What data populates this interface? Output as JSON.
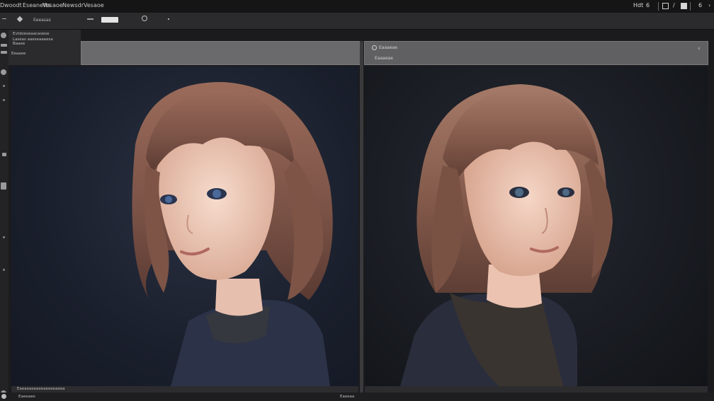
{
  "menu": {
    "items": [
      "Dwoodt",
      "Eseanetts",
      "Vesaoe",
      "Newsdr",
      "Vesaoe"
    ]
  },
  "title_right": {
    "label": "Hdt",
    "glyph": "6",
    "glyph2": "6",
    "pen": "/"
  },
  "toolbar": {
    "left_label": "Eeeasas"
  },
  "info_panel": {
    "line1": "Evtdoeseaacaoese",
    "line2": "Laseas aaeseaaeesa",
    "line3": "Baaee",
    "line4": "Eeaaee"
  },
  "right_panel": {
    "title": "Eaaaeae",
    "subtitle": "Eaaaeae",
    "chevron": "‹"
  },
  "status": {
    "left": "Eaeaeaeeaeeaeeeeaeea",
    "bottom_left": "Eaeeaee",
    "bottom_mid": "Eaeeaa"
  },
  "colors": {
    "bg": "#1b1b1d",
    "panel": "#2b2b2d",
    "header_left": "#6a6a6c",
    "header_right": "#606062",
    "hair": "#8a5e4f",
    "skin": "#f0cdbc",
    "sweater": "#2c3247"
  },
  "icons": {
    "tool_strip": [
      "eye-icon",
      "crop-icon",
      "gear-icon",
      "brush-icon",
      "layers-icon"
    ],
    "title_bar": [
      "settings-icon",
      "pen-icon",
      "window-icon",
      "close-icon"
    ]
  }
}
